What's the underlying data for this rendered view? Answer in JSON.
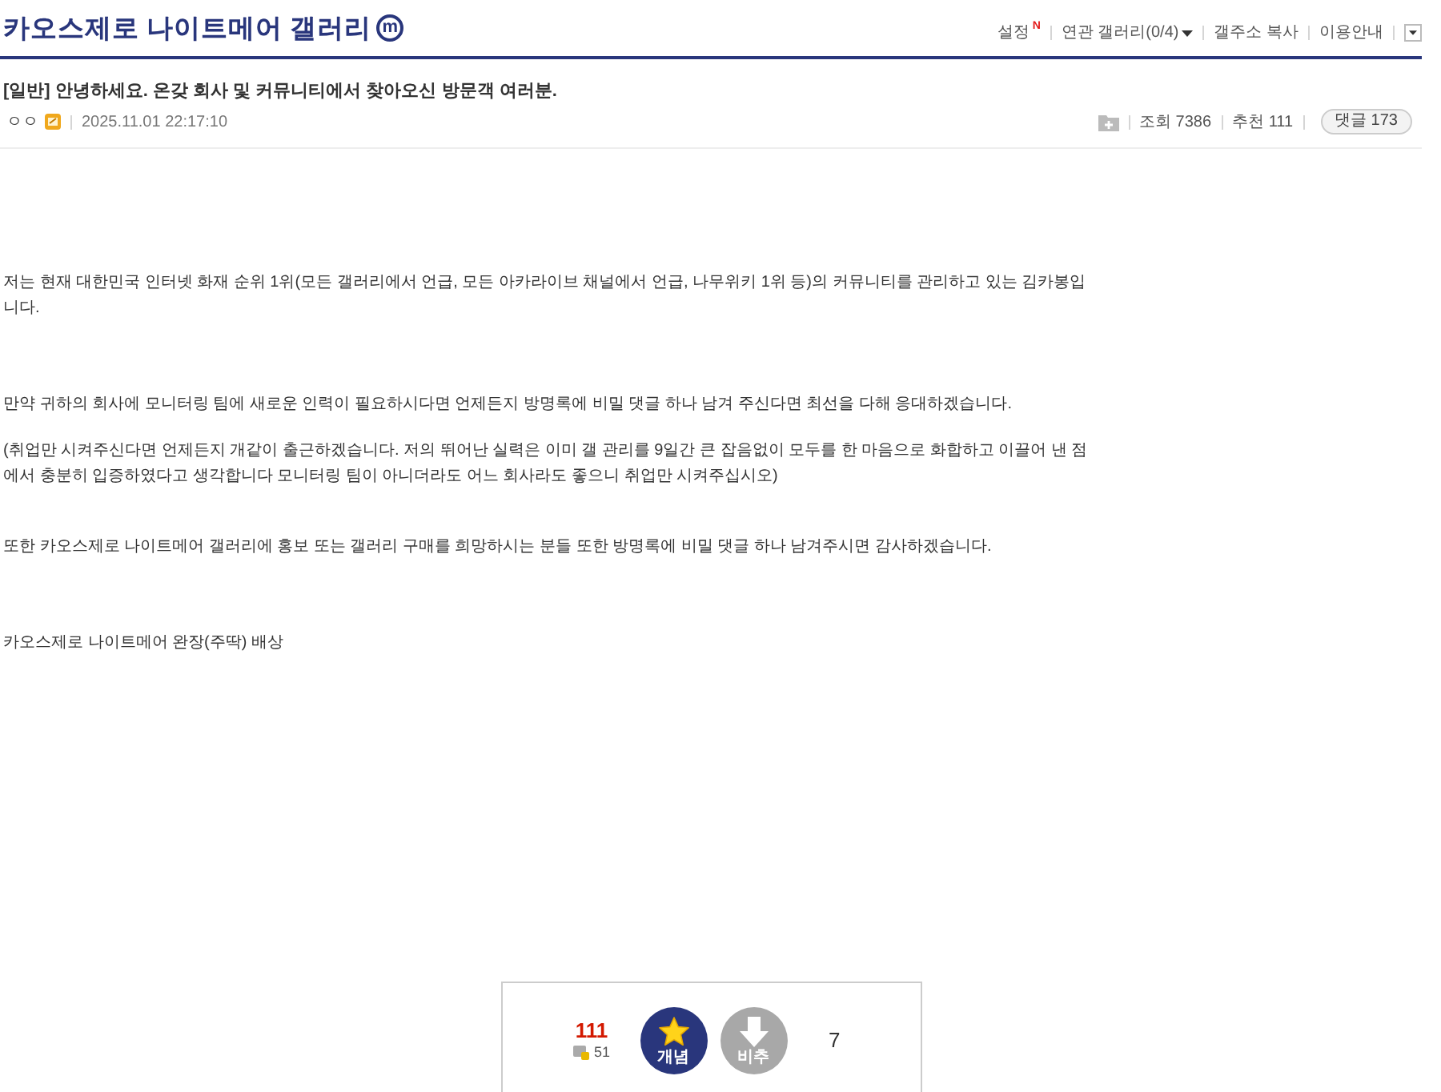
{
  "gallery": {
    "title": "카오스제로 나이트메어 갤러리",
    "badge": "m"
  },
  "header_links": [
    {
      "label": "설정",
      "badge": "N",
      "has_menu": false
    },
    {
      "label": "연관 갤러리(0/4)",
      "has_menu": true
    },
    {
      "label": "갤주소 복사",
      "has_menu": false
    },
    {
      "label": "이용안내",
      "has_menu": false
    }
  ],
  "post": {
    "title": "[일반] 안녕하세요. 온갖 회사 및 커뮤니티에서 찾아오신 방문객 여러분.",
    "author": "ㅇㅇ",
    "date": "2025.11.01 22:17:10",
    "stats": [
      {
        "label": "조회 7386"
      },
      {
        "label": "추천 111"
      }
    ],
    "comments": "댓글 173"
  },
  "body": [
    "저는 현재 대한민국 인터넷 화재 순위 1위(모든 갤러리에서 언급, 모든 아카라이브 채널에서 언급, 나무위키 1위 등)의 커뮤니티를 관리하고 있는 김카봉입니다.",
    "만약 귀하의 회사에 모니터링 팀에 새로운 인력이 필요하시다면 언제든지 방명록에 비밀 댓글 하나 남겨 주신다면 최선을 다해 응대하겠습니다.",
    "(취업만 시켜주신다면 언제든지 개같이 출근하겠습니다. 저의 뛰어난 실력은 이미 갤 관리를 9일간 큰 잡음없이 모두를 한 마음으로 화합하고 이끌어 낸 점에서 충분히 입증하였다고 생각합니다 모니터링 팀이 아니더라도 어느 회사라도 좋으니 취업만 시켜주십시오)",
    "또한 카오스제로 나이트메어 갤러리에 홍보 또는 갤러리 구매를 희망하시는 분들 또한 방명록에 비밀 댓글 하나 남겨주시면 감사하겠습니다.",
    "카오스제로 나이트메어 완장(주딱) 배상"
  ],
  "vote": {
    "up_count": "111",
    "fixed_count": "51",
    "up_label": "개념",
    "down_label": "비추",
    "down_count": "7"
  }
}
